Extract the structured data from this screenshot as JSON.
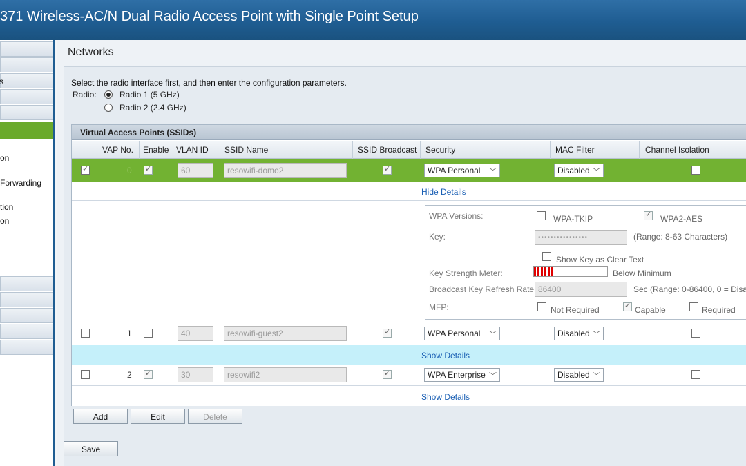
{
  "header": {
    "title": "371 Wireless-AC/N Dual Radio Access Point with Single Point Setup"
  },
  "sidebar": {
    "items": [
      "s",
      "on",
      "Forwarding",
      "tion",
      "on"
    ]
  },
  "page": {
    "title": "Networks",
    "instruction": "Select the radio interface first, and then enter the configuration parameters.",
    "radio_label": "Radio:",
    "radio_options": [
      {
        "label": "Radio 1 (5 GHz)",
        "selected": true
      },
      {
        "label": "Radio 2 (2.4 GHz)",
        "selected": false
      }
    ]
  },
  "table": {
    "title": "Virtual Access Points (SSIDs)",
    "columns": [
      "VAP No.",
      "Enable",
      "VLAN ID",
      "SSID Name",
      "SSID Broadcast",
      "Security",
      "MAC Filter",
      "Channel Isolation"
    ],
    "rows": [
      {
        "vap": "0",
        "vlan": "60",
        "ssid": "resowifi-domo2",
        "security": "WPA Personal",
        "mac_filter": "Disabled",
        "details_link": "Hide Details"
      },
      {
        "vap": "1",
        "vlan": "40",
        "ssid": "resowifi-guest2",
        "security": "WPA Personal",
        "mac_filter": "Disabled",
        "details_link": "Show Details"
      },
      {
        "vap": "2",
        "vlan": "30",
        "ssid": "resowifi2",
        "security": "WPA Enterprise",
        "mac_filter": "Disabled",
        "details_link": "Show Details"
      }
    ]
  },
  "details": {
    "wpa_versions_label": "WPA Versions:",
    "wpa_tkip": "WPA-TKIP",
    "wpa2_aes": "WPA2-AES",
    "key_label": "Key:",
    "key_value": "••••••••••••••••",
    "key_range": "(Range: 8-63 Characters)",
    "show_key": "Show Key as Clear Text",
    "strength_label": "Key Strength Meter:",
    "strength_level": 0.25,
    "strength_text": "Below Minimum",
    "refresh_label": "Broadcast Key Refresh Rate",
    "refresh_value": "86400",
    "refresh_range": "Sec (Range: 0-86400, 0 = Disa",
    "mfp_label": "MFP:",
    "mfp_not_required": "Not Required",
    "mfp_capable": "Capable",
    "mfp_required": "Required"
  },
  "buttons": {
    "add": "Add",
    "edit": "Edit",
    "delete": "Delete",
    "save": "Save"
  }
}
